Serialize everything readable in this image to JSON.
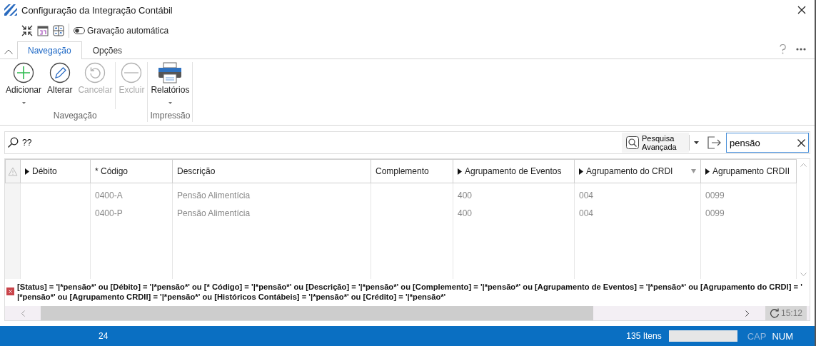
{
  "window": {
    "title": "Configuração da Integração Contábil"
  },
  "quick_toolbar": {
    "autosave": {
      "label": "Gravação automática",
      "on": false
    }
  },
  "tabs": [
    {
      "label": "Navegação",
      "selected": true
    },
    {
      "label": "Opções",
      "selected": false
    }
  ],
  "ribbon": {
    "groups": [
      {
        "label": "Navegação",
        "sections": [
          [
            {
              "label": "Adicionar",
              "kind": "add",
              "disabled": false,
              "dropdown": true
            },
            {
              "label": "Alterar",
              "kind": "edit",
              "disabled": false,
              "dropdown": false
            },
            {
              "label": "Cancelar",
              "kind": "undo",
              "disabled": true,
              "dropdown": false
            }
          ],
          [
            {
              "label": "Excluir",
              "kind": "remove",
              "disabled": true,
              "dropdown": false
            }
          ]
        ]
      },
      {
        "label": "Impressão",
        "sections": [
          [
            {
              "label": "Relatórios",
              "kind": "print",
              "disabled": false,
              "dropdown": true
            }
          ]
        ]
      }
    ]
  },
  "search_bar": {
    "query": "??",
    "advanced_label": "Pesquisa Avançada",
    "filter_value": "pensão"
  },
  "table": {
    "columns": [
      {
        "label": "Débito",
        "expandable": true,
        "filter": false
      },
      {
        "label": "* Código",
        "expandable": false,
        "filter": false
      },
      {
        "label": "Descrição",
        "expandable": false,
        "filter": false
      },
      {
        "label": "Complemento",
        "expandable": false,
        "filter": false
      },
      {
        "label": "Agrupamento de Eventos",
        "expandable": true,
        "filter": false
      },
      {
        "label": "Agrupamento do CRDI",
        "expandable": true,
        "filter": true
      },
      {
        "label": "Agrupamento CRDII",
        "expandable": true,
        "filter": false
      }
    ],
    "rows": [
      {
        "cells": [
          "",
          "0400-A",
          "Pensão Alimentícia",
          "",
          "400",
          "004",
          "0099"
        ]
      },
      {
        "cells": [
          "",
          "0400-P",
          "Pensão Alimentícia",
          "",
          "400",
          "004",
          "0099"
        ]
      }
    ]
  },
  "filter_message": "[Status] = '|*pensão*' ou [Débito] = '|*pensão*' ou [* Código] = '|*pensão*' ou [Descrição] = '|*pensão*' ou [Complemento] = '|*pensão*' ou [Agrupamento de Eventos] = '|*pensão*' ou [Agrupamento do CRDI] = ' |*pensão*' ou [Agrupamento CRDII] = '|*pensão*' ou [Históricos Contábeis] = '|*pensão*' ou [Crédito] = '|*pensão*'",
  "refresh_time": "15:12",
  "status_bar": {
    "count": "24",
    "items": "135 Itens",
    "indicators": [
      {
        "label": "CAP",
        "on": false
      },
      {
        "label": "NUM",
        "on": true
      }
    ]
  }
}
